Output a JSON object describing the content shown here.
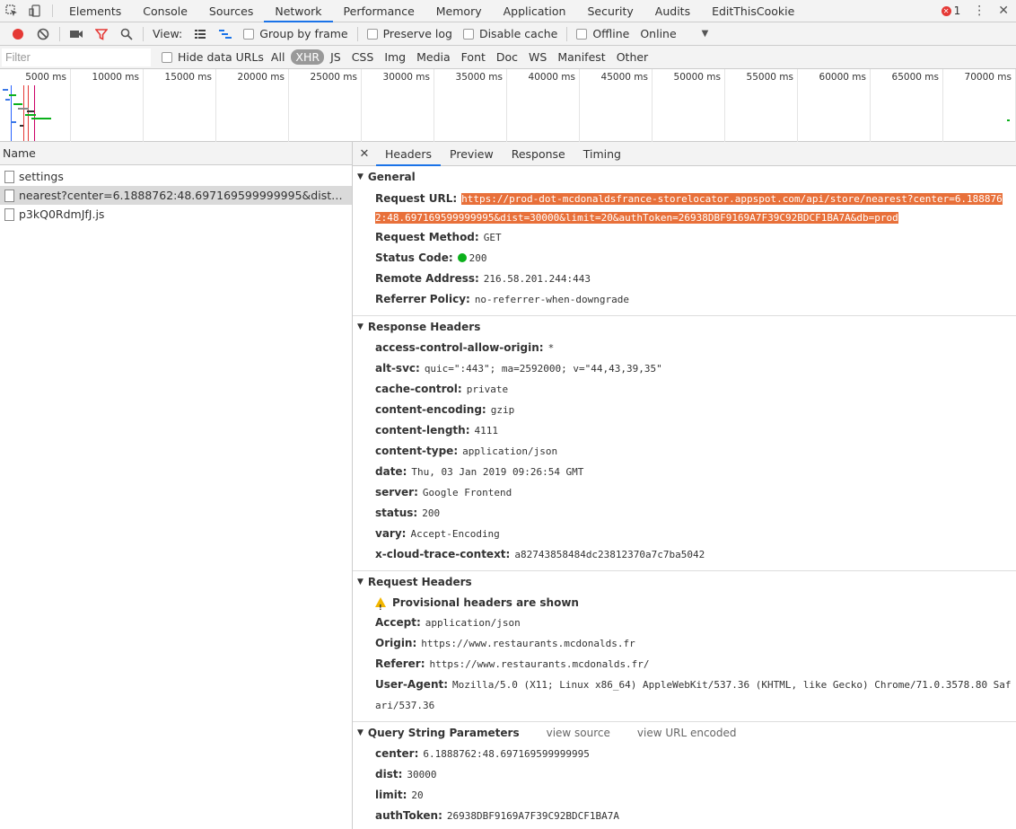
{
  "tabs": [
    "Elements",
    "Console",
    "Sources",
    "Network",
    "Performance",
    "Memory",
    "Application",
    "Security",
    "Audits",
    "EditThisCookie"
  ],
  "active_tab": "Network",
  "error_count": "1",
  "toolbar": {
    "view_label": "View:",
    "group_by_frame": "Group by frame",
    "preserve_log": "Preserve log",
    "disable_cache": "Disable cache",
    "offline": "Offline",
    "throttle": "Online"
  },
  "filter": {
    "placeholder": "Filter",
    "hide_data_urls": "Hide data URLs",
    "types": [
      "All",
      "XHR",
      "JS",
      "CSS",
      "Img",
      "Media",
      "Font",
      "Doc",
      "WS",
      "Manifest",
      "Other"
    ],
    "active_type": "XHR"
  },
  "timeline_ticks": [
    "5000 ms",
    "10000 ms",
    "15000 ms",
    "20000 ms",
    "25000 ms",
    "30000 ms",
    "35000 ms",
    "40000 ms",
    "45000 ms",
    "50000 ms",
    "55000 ms",
    "60000 ms",
    "65000 ms",
    "70000 ms"
  ],
  "requests": {
    "column": "Name",
    "items": [
      "settings",
      "nearest?center=6.1888762:48.697169599999995&dist=3…0&authToken=26938DBF9169A7F39C92BDCF1BA7A&db=prod",
      "p3kQ0RdmJfJ.js"
    ]
  },
  "detail_tabs": [
    "Headers",
    "Preview",
    "Response",
    "Timing"
  ],
  "general": {
    "title": "General",
    "request_url_key": "Request URL:",
    "request_url": "https://prod-dot-mcdonaldsfrance-storelocator.appspot.com/api/store/nearest?center=6.1888762:48.697169599999995&dist=30000&limit=20&authToken=26938DBF9169A7F39C92BDCF1BA7A&db=prod",
    "request_method_key": "Request Method:",
    "request_method": "GET",
    "status_code_key": "Status Code:",
    "status_code": "200",
    "remote_address_key": "Remote Address:",
    "remote_address": "216.58.201.244:443",
    "referrer_policy_key": "Referrer Policy:",
    "referrer_policy": "no-referrer-when-downgrade"
  },
  "response_headers": {
    "title": "Response Headers",
    "rows": [
      {
        "k": "access-control-allow-origin:",
        "v": "*"
      },
      {
        "k": "alt-svc:",
        "v": "quic=\":443\"; ma=2592000; v=\"44,43,39,35\""
      },
      {
        "k": "cache-control:",
        "v": "private"
      },
      {
        "k": "content-encoding:",
        "v": "gzip"
      },
      {
        "k": "content-length:",
        "v": "4111"
      },
      {
        "k": "content-type:",
        "v": "application/json"
      },
      {
        "k": "date:",
        "v": "Thu, 03 Jan 2019 09:26:54 GMT"
      },
      {
        "k": "server:",
        "v": "Google Frontend"
      },
      {
        "k": "status:",
        "v": "200"
      },
      {
        "k": "vary:",
        "v": "Accept-Encoding"
      },
      {
        "k": "x-cloud-trace-context:",
        "v": "a82743858484dc23812370a7c7ba5042"
      }
    ]
  },
  "request_headers": {
    "title": "Request Headers",
    "provisional": "Provisional headers are shown",
    "rows": [
      {
        "k": "Accept:",
        "v": "application/json"
      },
      {
        "k": "Origin:",
        "v": "https://www.restaurants.mcdonalds.fr"
      },
      {
        "k": "Referer:",
        "v": "https://www.restaurants.mcdonalds.fr/"
      },
      {
        "k": "User-Agent:",
        "v": "Mozilla/5.0 (X11; Linux x86_64) AppleWebKit/537.36 (KHTML, like Gecko) Chrome/71.0.3578.80 Safari/537.36"
      }
    ]
  },
  "query_params": {
    "title": "Query String Parameters",
    "view_source": "view source",
    "view_url_encoded": "view URL encoded",
    "rows": [
      {
        "k": "center:",
        "v": "6.1888762:48.697169599999995"
      },
      {
        "k": "dist:",
        "v": "30000"
      },
      {
        "k": "limit:",
        "v": "20"
      },
      {
        "k": "authToken:",
        "v": "26938DBF9169A7F39C92BDCF1BA7A"
      },
      {
        "k": "db:",
        "v": "prod"
      }
    ]
  },
  "colors": {
    "record": "#e53935",
    "filter_icon": "#e53935",
    "active_tab_underline": "#1a73e8",
    "url_highlight": "#e8703a",
    "status_ok": "#0bb01b"
  }
}
